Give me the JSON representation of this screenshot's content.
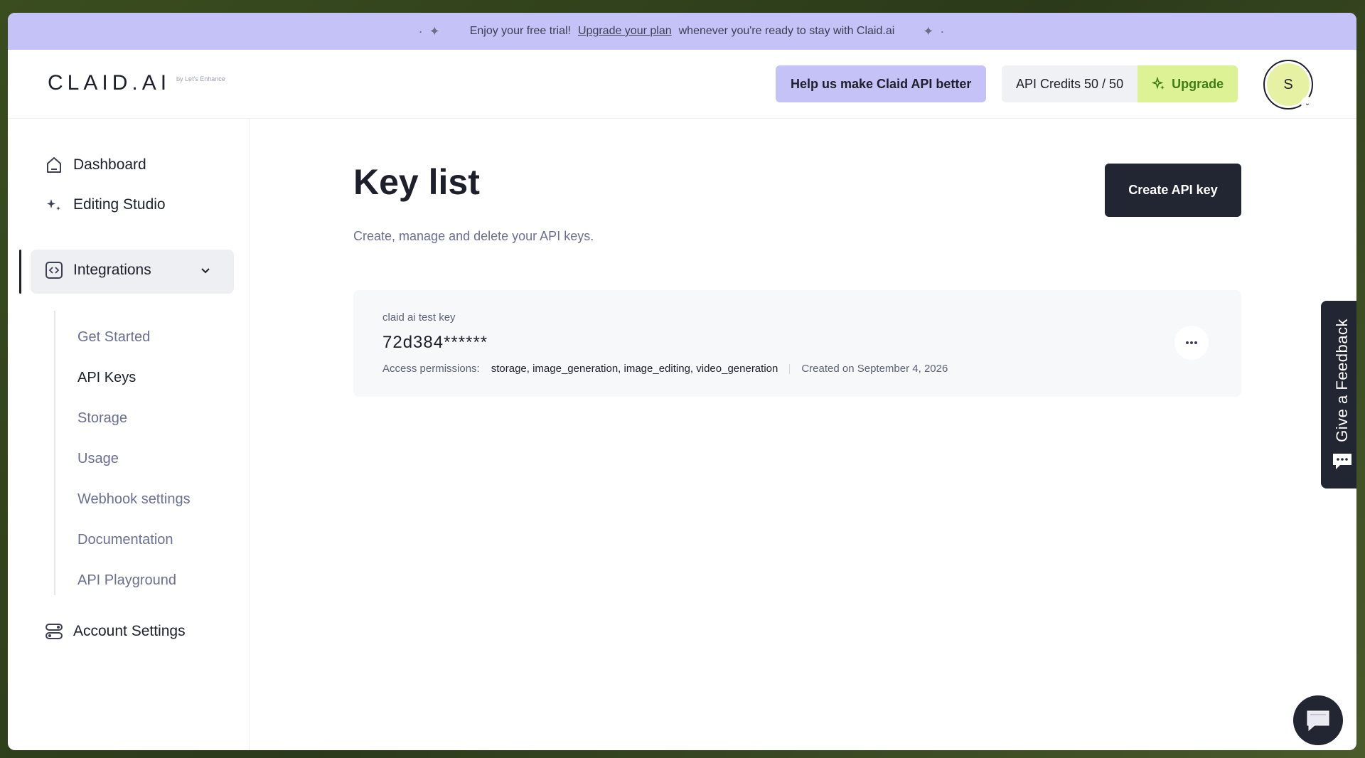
{
  "banner": {
    "pre_text": "Enjoy your free trial!",
    "link_text": "Upgrade your plan",
    "post_text": "whenever you're ready to stay with Claid.ai"
  },
  "header": {
    "logo": "CLAID.AI",
    "logo_sub": "by Let's Enhance",
    "help_button": "Help us make Claid API better",
    "credits": "API Credits 50 / 50",
    "upgrade_button": "Upgrade",
    "avatar_initial": "S"
  },
  "sidebar": {
    "dashboard": "Dashboard",
    "editing_studio": "Editing Studio",
    "integrations": "Integrations",
    "sub_items": [
      "Get Started",
      "API Keys",
      "Storage",
      "Usage",
      "Webhook settings",
      "Documentation",
      "API Playground"
    ],
    "account_settings": "Account Settings"
  },
  "main": {
    "title": "Key list",
    "subtitle": "Create, manage and delete your API keys.",
    "create_button": "Create API key",
    "key": {
      "name": "claid ai test key",
      "value": "72d384******",
      "permissions_label": "Access permissions:",
      "permissions": "storage, image_generation, image_editing, video_generation",
      "created": "Created on September 4, 2026"
    }
  },
  "feedback": {
    "label": "Give a Feedback"
  },
  "colors": {
    "banner_bg": "#c4c2f7",
    "upgrade_bg": "#ddf294",
    "dark": "#222532",
    "accent_text": "#6a6f92"
  }
}
